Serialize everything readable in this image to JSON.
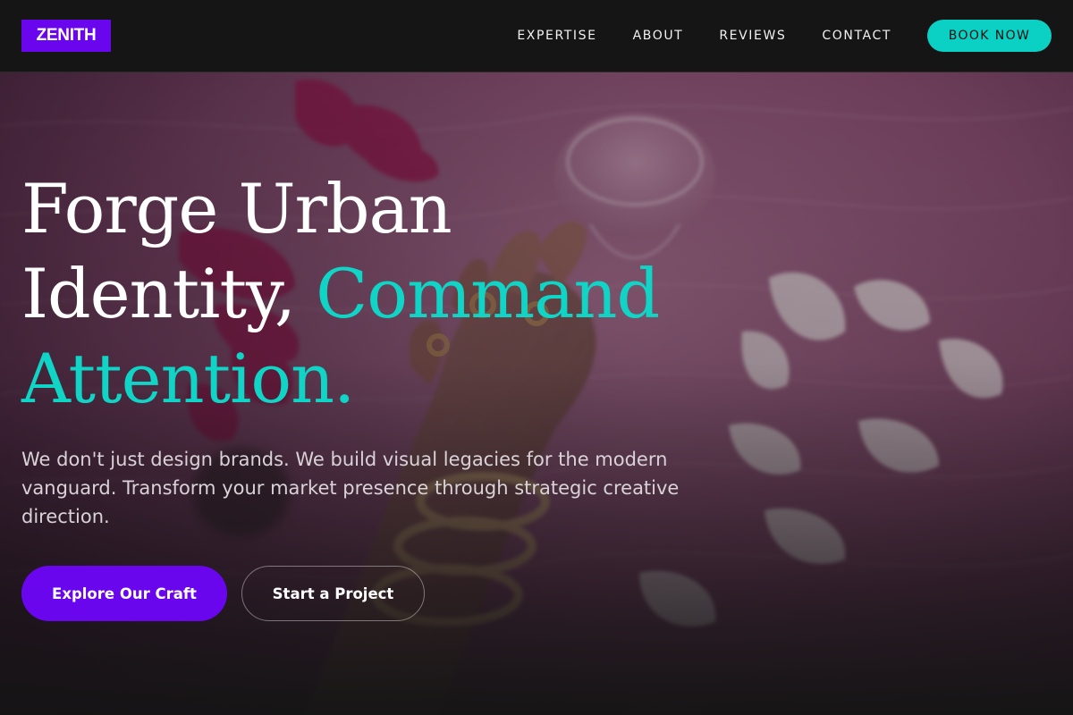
{
  "brand": {
    "logo_text": "ZENITH",
    "logo_color": "#6a06ee"
  },
  "nav": {
    "links": [
      {
        "label": "EXPERTISE"
      },
      {
        "label": "ABOUT"
      },
      {
        "label": "REVIEWS"
      },
      {
        "label": "CONTACT"
      }
    ],
    "cta_label": "BOOK NOW",
    "cta_color": "#0ad1c4"
  },
  "hero": {
    "background_image": "photo of a hand with gold rings and chain bracelets holding a glass on pink fur with scattered white petals",
    "headline": {
      "line1": "Forge Urban",
      "line2_plain": "Identity,",
      "line2_accent": "Command",
      "line3_accent": "Attention."
    },
    "accent_color": "#10d4c6",
    "subtext": "We don't just design brands. We build visual legacies for the modern vanguard. Transform your market presence through strategic creative direction.",
    "primary_button": "Explore Our Craft",
    "secondary_button": "Start a Project"
  }
}
